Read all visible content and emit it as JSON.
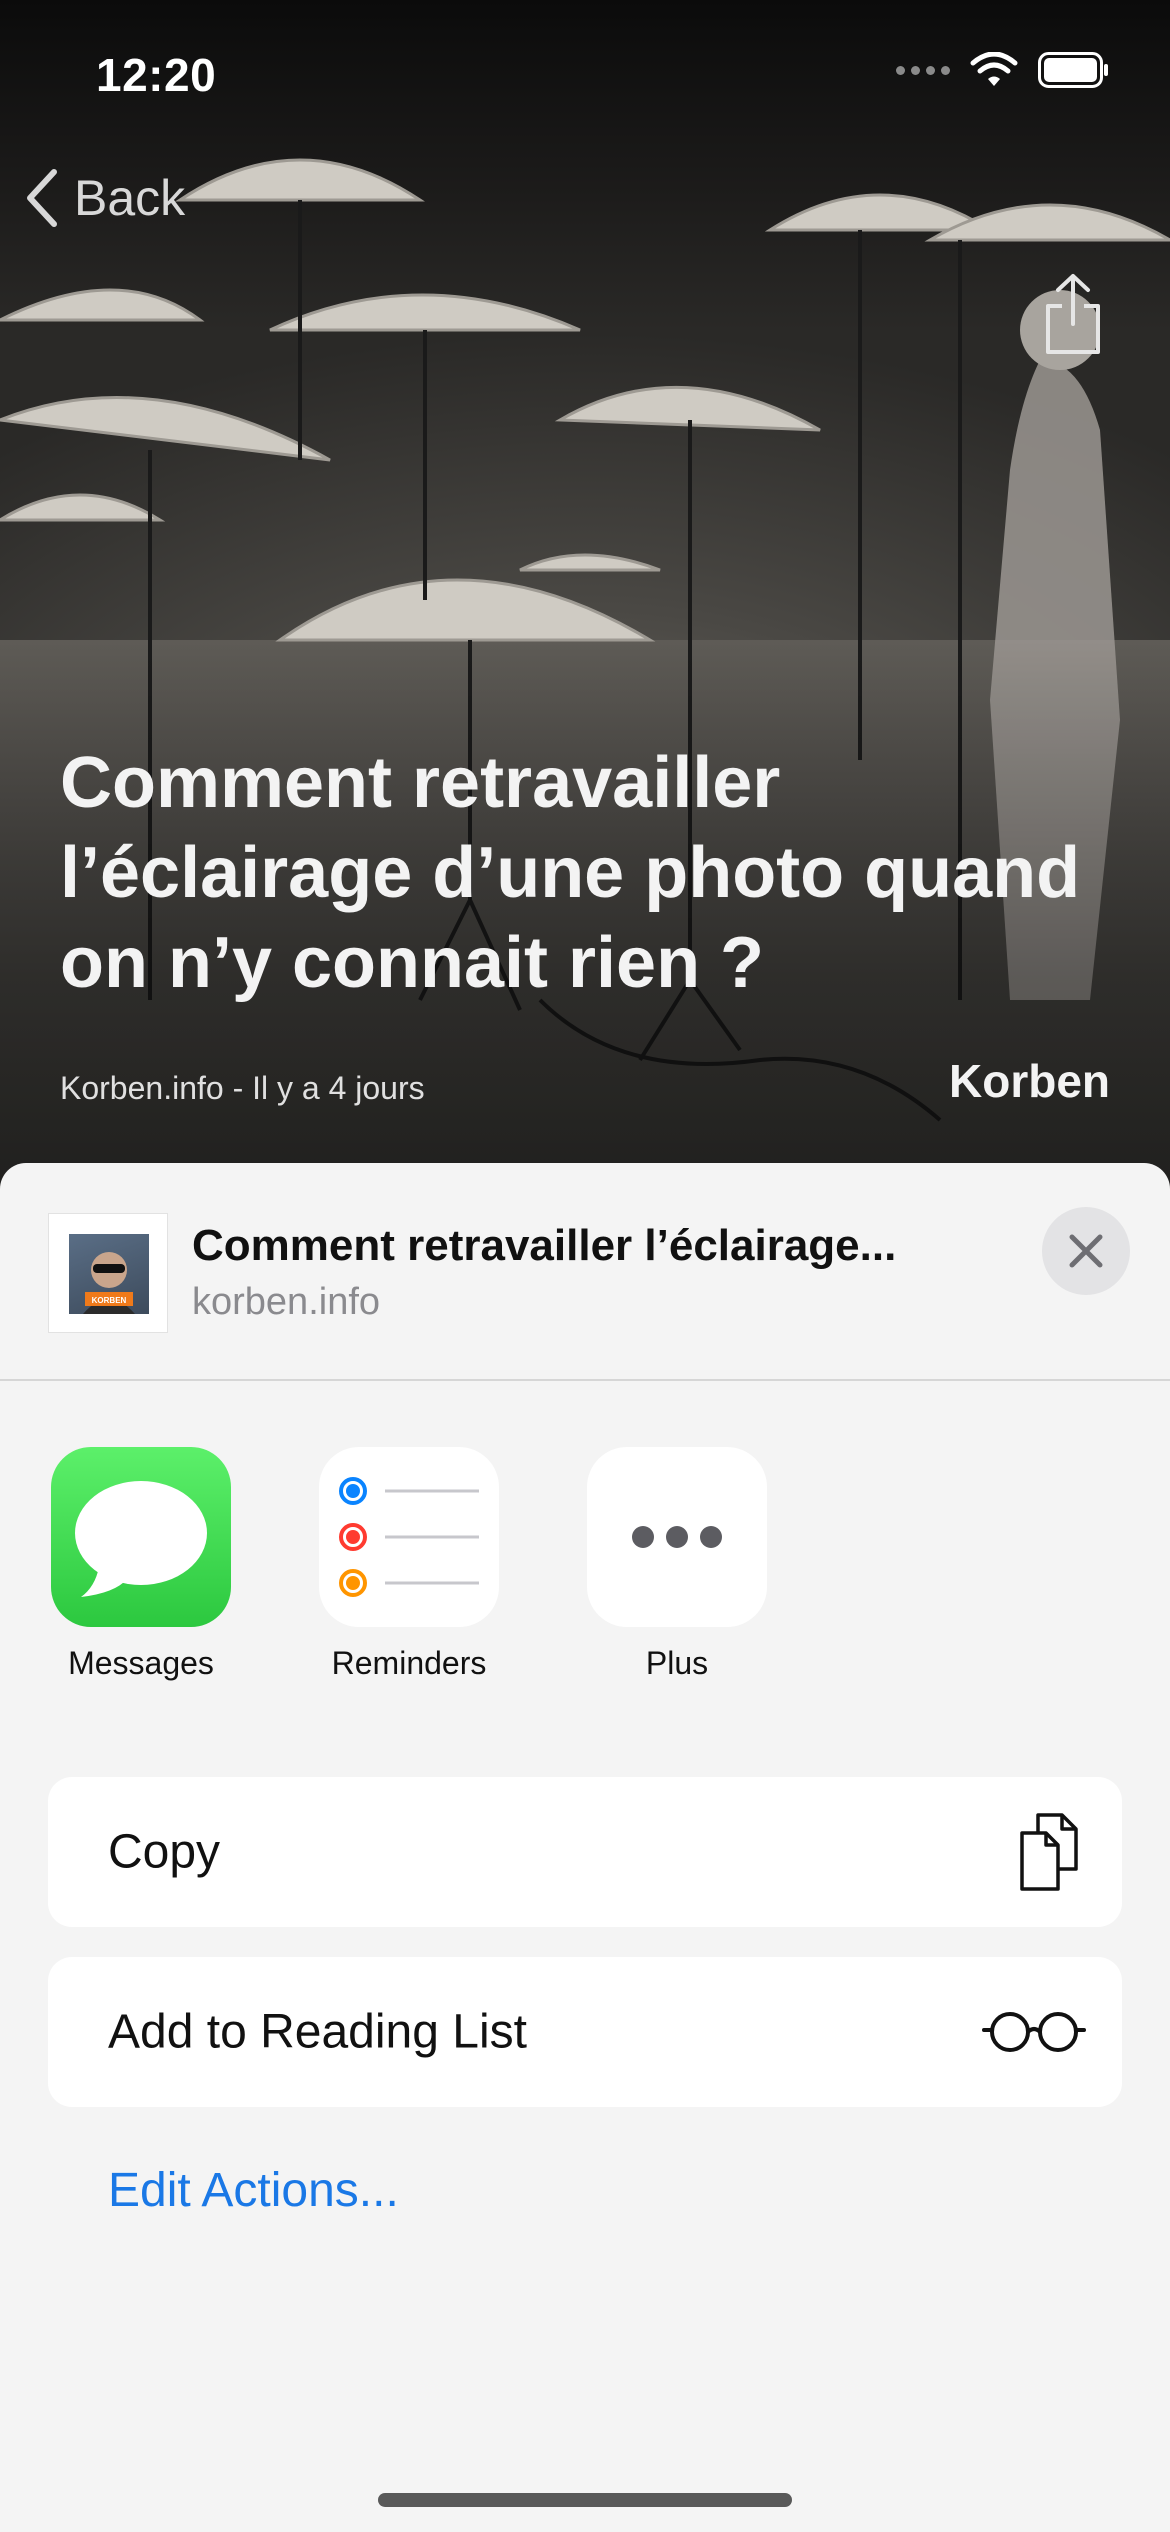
{
  "status_bar": {
    "time": "12:20",
    "icons": [
      "signal-icon",
      "wifi-icon",
      "battery-icon"
    ]
  },
  "nav": {
    "back_label": "Back",
    "share_icon": "share-icon"
  },
  "article": {
    "title": "Comment retravailler l’éclairage d’une photo quand on n’y connait rien ?",
    "meta": "Korben.info - Il y a 4 jours",
    "author": "Korben"
  },
  "share_sheet": {
    "title": "Comment retravailler l’éclairage...",
    "domain": "korben.info",
    "thumbnail_caption": "KORBEN",
    "apps": [
      {
        "label": "Messages",
        "icon": "messages-icon"
      },
      {
        "label": "Reminders",
        "icon": "reminders-icon"
      },
      {
        "label": "Plus",
        "icon": "more-icon"
      }
    ],
    "actions": [
      {
        "label": "Copy",
        "icon": "copy-icon"
      },
      {
        "label": "Add to Reading List",
        "icon": "reading-list-glasses-icon"
      }
    ],
    "edit_actions_label": "Edit Actions..."
  },
  "colors": {
    "accent": "#1a78e6",
    "messages_green": "#34c759",
    "reminder_blue": "#0a84ff",
    "reminder_red": "#ff3b30",
    "reminder_orange": "#ff9500"
  }
}
